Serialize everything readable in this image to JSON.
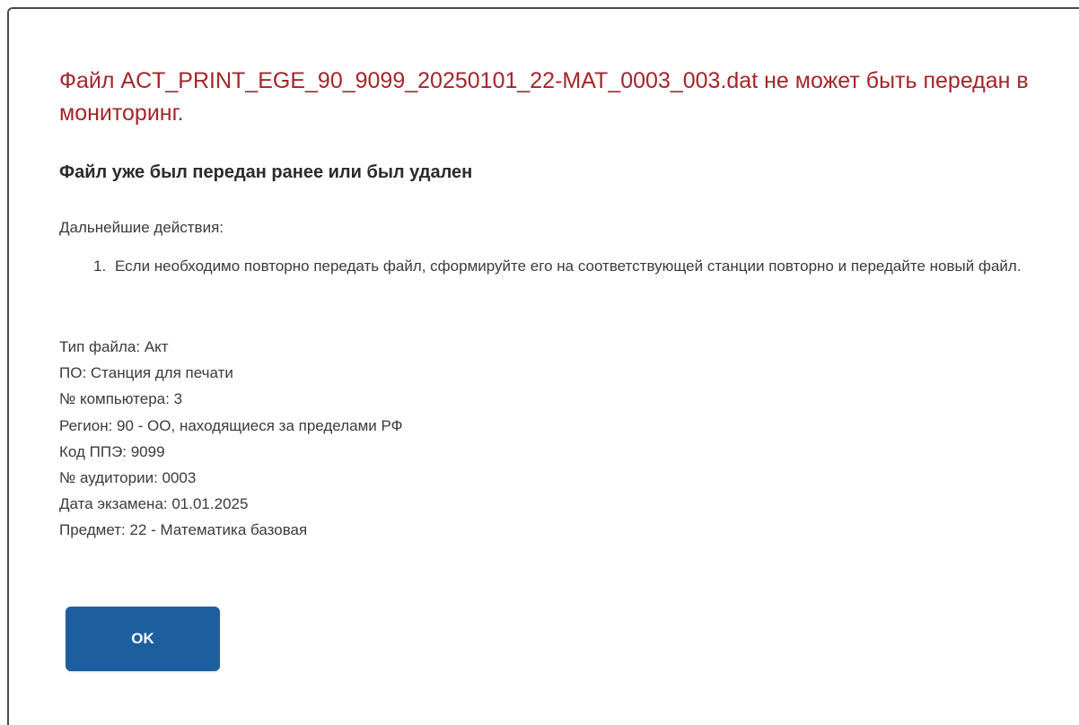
{
  "dialog": {
    "title": "Файл ACT_PRINT_EGE_90_9099_20250101_22-MAT_0003_003.dat не может быть передан в мониторинг.",
    "subtitle": "Файл уже был передан ранее или был удален",
    "actions_label": "Дальнейшие действия:",
    "steps": [
      {
        "number": "1.",
        "text": "Если необходимо повторно передать файл, сформируйте его на соответствующей станции повторно и передайте новый файл."
      }
    ],
    "details": [
      "Тип файла: Акт",
      "ПО: Станция для печати",
      "№ компьютера: 3",
      "Регион: 90 - ОО, находящиеся за пределами РФ",
      "Код ППЭ: 9099",
      "№ аудитории: 0003",
      "Дата экзамена: 01.01.2025",
      "Предмет: 22 - Математика базовая"
    ],
    "ok_label": "OK"
  },
  "colors": {
    "title": "#a3262a",
    "button": "#1d5f9e",
    "text": "#3a3a3a"
  }
}
